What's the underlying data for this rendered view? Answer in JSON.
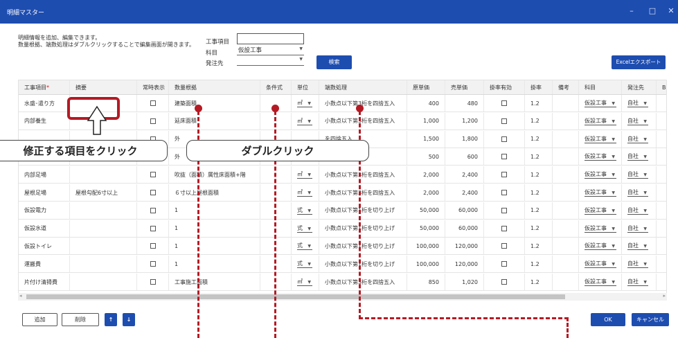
{
  "window": {
    "title": "明細マスター",
    "minimize": "–",
    "maximize": "□",
    "close": "✕"
  },
  "description": {
    "line1": "明細情報を追加、編集できます。",
    "line2": "数量根拠、端数処理はダブルクリックすることで編集画面が開きます。"
  },
  "filters": {
    "project_label": "工事項目",
    "project_value": "",
    "category_label": "科目",
    "category_value": "仮設工事",
    "order_label": "発注先",
    "order_value": ""
  },
  "buttons": {
    "search": "検索",
    "excel_export": "Excelエクスポート",
    "add": "追加",
    "delete": "削除",
    "up": "↑",
    "down": "↓",
    "ok": "OK",
    "cancel": "キャンセル"
  },
  "columns": [
    "工事項目",
    "摘要",
    "常時表示",
    "数量根拠",
    "条件式",
    "単位",
    "端数処理",
    "原単価",
    "売単価",
    "掛率有効",
    "掛率",
    "備考",
    "科目",
    "発注先",
    "B"
  ],
  "required_mark": "*",
  "rows": [
    {
      "item": "水盛･遣り方",
      "summary": "",
      "basis": "建築面積",
      "cond": "",
      "unit": "㎡",
      "rounding": "小数点以下第3桁を四捨五入",
      "cost": "400",
      "price": "480",
      "rate": "1.2",
      "note": "",
      "category": "仮設工事",
      "vendor": "自社",
      "extra": ""
    },
    {
      "item": "内部養生",
      "summary": "",
      "basis": "延床面積",
      "cond": "",
      "unit": "㎡",
      "rounding": "小数点以下第3桁を四捨五入",
      "cost": "1,000",
      "price": "1,200",
      "rate": "1.2",
      "note": "",
      "category": "仮設工事",
      "vendor": "自社",
      "extra": ""
    },
    {
      "item": "",
      "summary": "",
      "basis": "外",
      "cond": "",
      "unit": "",
      "rounding": "を四捨五入",
      "cost": "1,500",
      "price": "1,800",
      "rate": "1.2",
      "note": "",
      "category": "仮設工事",
      "vendor": "自社",
      "extra": ""
    },
    {
      "item": "",
      "summary": "",
      "basis": "外",
      "cond": "",
      "unit": "",
      "rounding": "を四捨五入",
      "cost": "500",
      "price": "600",
      "rate": "1.2",
      "note": "",
      "category": "仮設工事",
      "vendor": "自社",
      "extra": ""
    },
    {
      "item": "内部足場",
      "summary": "",
      "basis": "吹抜（面積）属性床面積+階",
      "cond": "",
      "unit": "㎡",
      "rounding": "小数点以下第3桁を四捨五入",
      "cost": "2,000",
      "price": "2,400",
      "rate": "1.2",
      "note": "",
      "category": "仮設工事",
      "vendor": "自社",
      "extra": ""
    },
    {
      "item": "屋根足場",
      "summary": "屋根勾配6寸以上",
      "basis": "６寸以上屋根面積",
      "cond": "",
      "unit": "㎡",
      "rounding": "小数点以下第3桁を四捨五入",
      "cost": "2,000",
      "price": "2,400",
      "rate": "1.2",
      "note": "",
      "category": "仮設工事",
      "vendor": "自社",
      "extra": ""
    },
    {
      "item": "仮設電力",
      "summary": "",
      "basis": "1",
      "cond": "",
      "unit": "式",
      "rounding": "小数点以下第1桁を切り上げ",
      "cost": "50,000",
      "price": "60,000",
      "rate": "1.2",
      "note": "",
      "category": "仮設工事",
      "vendor": "自社",
      "extra": ""
    },
    {
      "item": "仮設水道",
      "summary": "",
      "basis": "1",
      "cond": "",
      "unit": "式",
      "rounding": "小数点以下第1桁を切り上げ",
      "cost": "50,000",
      "price": "60,000",
      "rate": "1.2",
      "note": "",
      "category": "仮設工事",
      "vendor": "自社",
      "extra": ""
    },
    {
      "item": "仮設トイレ",
      "summary": "",
      "basis": "1",
      "cond": "",
      "unit": "式",
      "rounding": "小数点以下第1桁を切り上げ",
      "cost": "100,000",
      "price": "120,000",
      "rate": "1.2",
      "note": "",
      "category": "仮設工事",
      "vendor": "自社",
      "extra": ""
    },
    {
      "item": "運搬費",
      "summary": "",
      "basis": "1",
      "cond": "",
      "unit": "式",
      "rounding": "小数点以下第1桁を切り上げ",
      "cost": "100,000",
      "price": "120,000",
      "rate": "1.2",
      "note": "",
      "category": "仮設工事",
      "vendor": "自社",
      "extra": ""
    },
    {
      "item": "片付け清掃費",
      "summary": "",
      "basis": "工事施工面積",
      "cond": "",
      "unit": "㎡",
      "rounding": "小数点以下第3桁を四捨五入",
      "cost": "850",
      "price": "1,020",
      "rate": "1.2",
      "note": "",
      "category": "仮設工事",
      "vendor": "自社",
      "extra": ""
    }
  ],
  "callouts": {
    "click": "修正する項目をクリック",
    "double_click": "ダブルクリック"
  },
  "colors": {
    "primary": "#1e4db0",
    "annotation": "#b51a24"
  }
}
